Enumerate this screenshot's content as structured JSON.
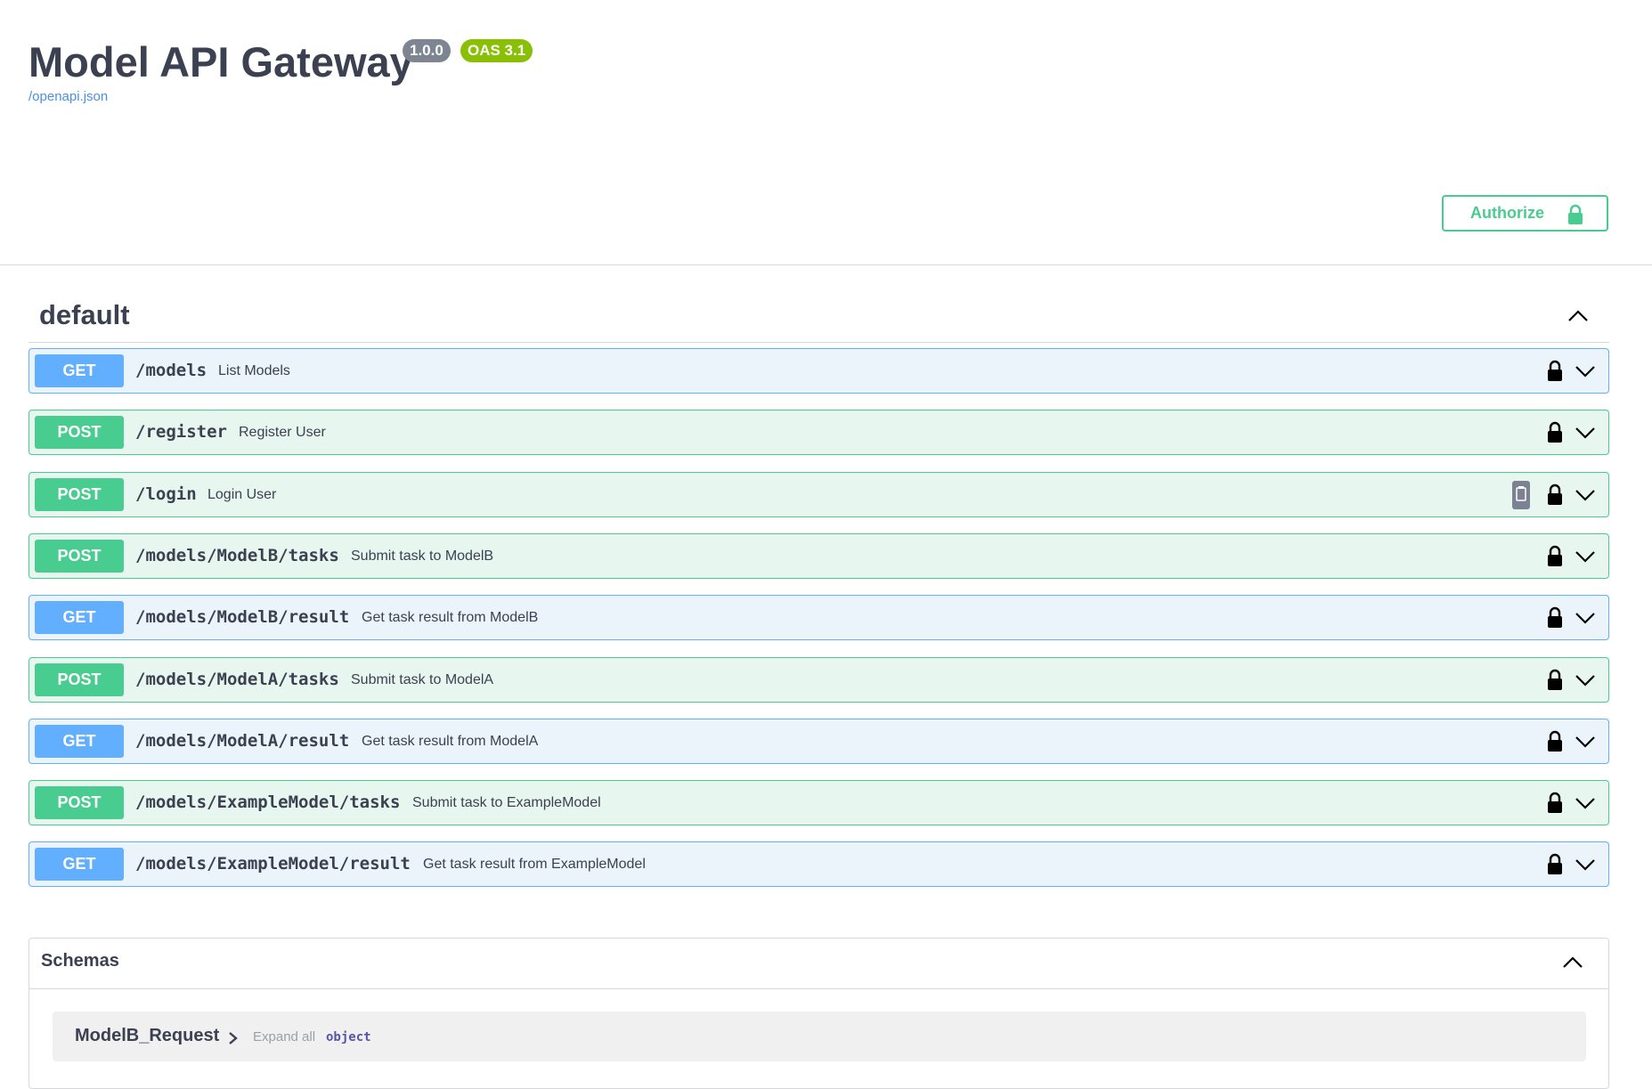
{
  "info": {
    "title": "Model API Gateway",
    "version": "1.0.0",
    "oas": "OAS 3.1",
    "spec_link": "/openapi.json"
  },
  "authorize": {
    "label": "Authorize",
    "icon": "lock-icon"
  },
  "section": {
    "title": "default",
    "toggle_icon": "chevron-up-icon"
  },
  "operations": [
    {
      "method": "GET",
      "path": "/models",
      "summary": "List Models"
    },
    {
      "method": "POST",
      "path": "/register",
      "summary": "Register User"
    },
    {
      "method": "POST",
      "path": "/login",
      "summary": "Login User"
    },
    {
      "method": "POST",
      "path": "/models/ModelB/tasks",
      "summary": "Submit task to ModelB"
    },
    {
      "method": "GET",
      "path": "/models/ModelB/result",
      "summary": "Get task result from ModelB"
    },
    {
      "method": "POST",
      "path": "/models/ModelA/tasks",
      "summary": "Submit task to ModelA"
    },
    {
      "method": "GET",
      "path": "/models/ModelA/result",
      "summary": "Get task result from ModelA"
    },
    {
      "method": "POST",
      "path": "/models/ExampleModel/tasks",
      "summary": "Submit task to ExampleModel"
    },
    {
      "method": "GET",
      "path": "/models/ExampleModel/result",
      "summary": "Get task result from ExampleModel"
    }
  ],
  "schemas": {
    "title": "Schemas",
    "models": [
      {
        "name": "ModelB_Request",
        "expand_all": "Expand all",
        "type": "object"
      }
    ]
  },
  "colors": {
    "get": "#61affe",
    "post": "#49cc90",
    "get_bg": "#ebf3fb",
    "post_bg": "#e8f6f0",
    "version_badge": "#7d8492",
    "oas_badge": "#89bf04",
    "link": "#4990e2"
  }
}
